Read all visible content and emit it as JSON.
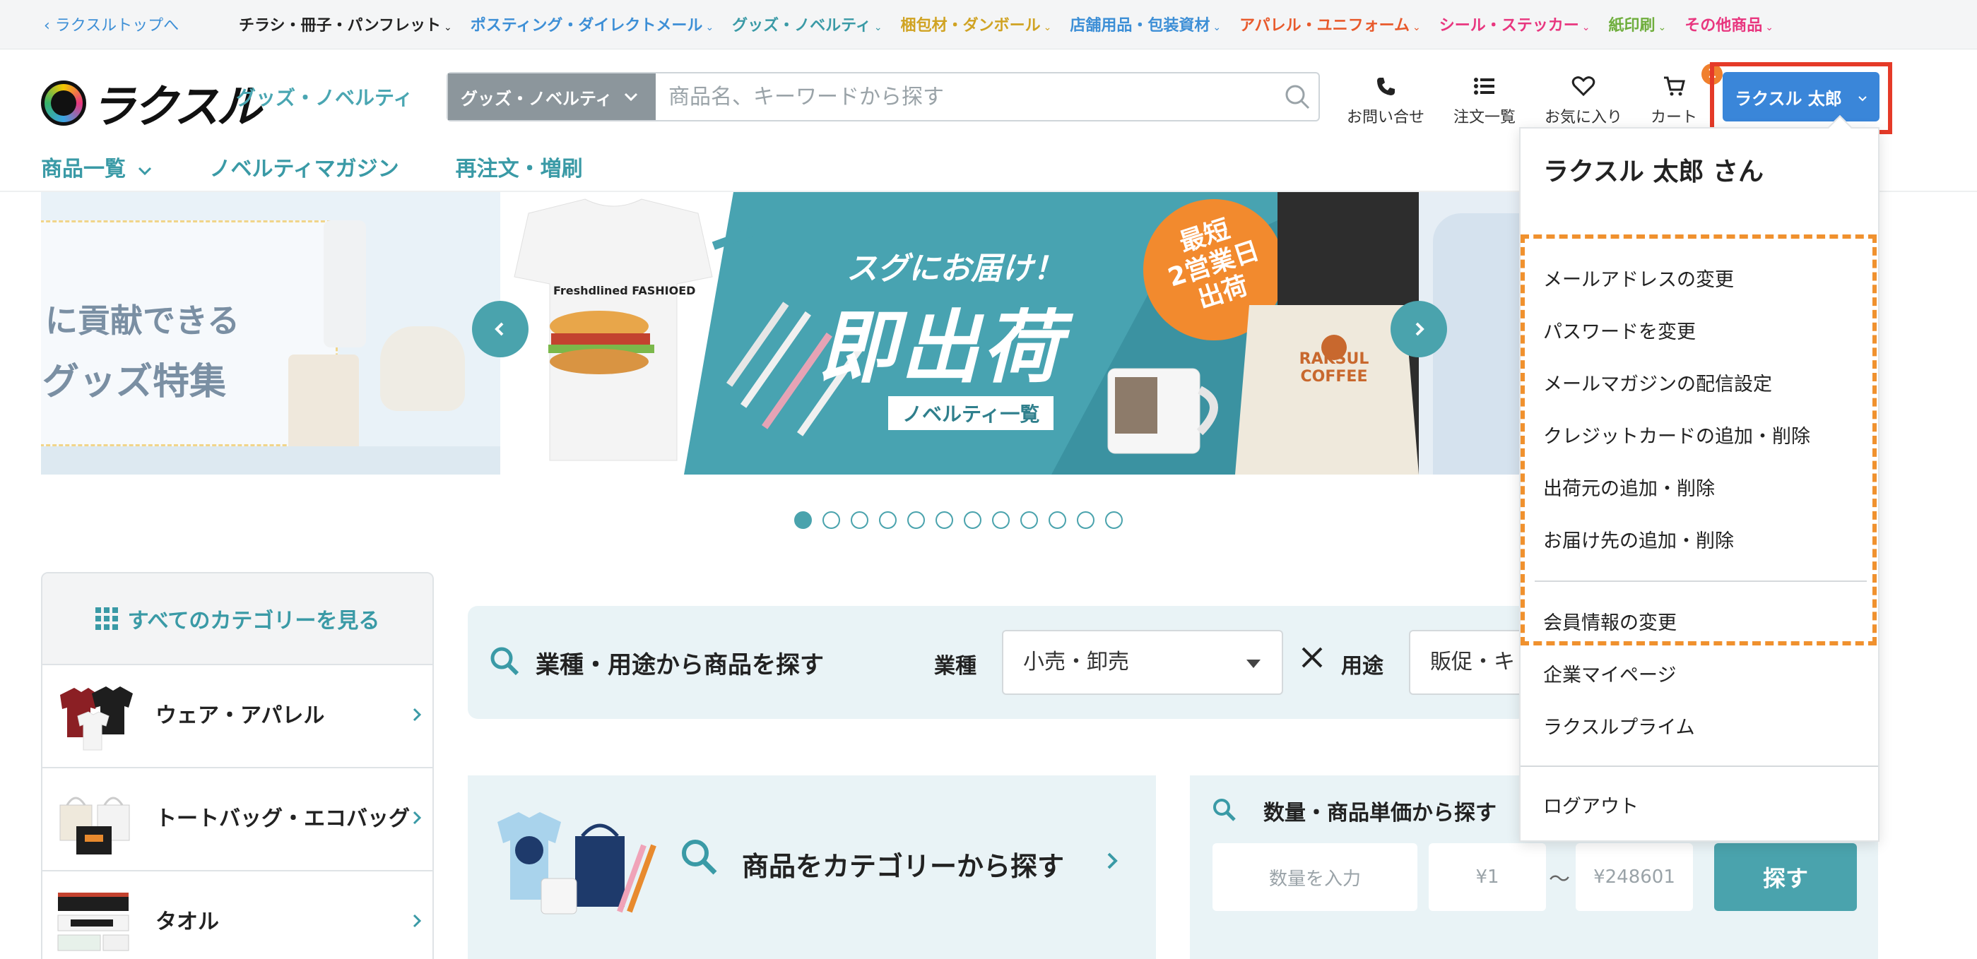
{
  "topbar": {
    "back_label": "ラクスルトップへ",
    "categories": [
      {
        "label": "チラシ・冊子・パンフレット",
        "color": "#222222"
      },
      {
        "label": "ポスティング・ダイレクトメール",
        "color": "#3d8fd6"
      },
      {
        "label": "グッズ・ノベルティ",
        "color": "#3a9aa6"
      },
      {
        "label": "梱包材・ダンボール",
        "color": "#d0a323"
      },
      {
        "label": "店舗用品・包装資材",
        "color": "#3d8fd6"
      },
      {
        "label": "アパレル・ユニフォーム",
        "color": "#e85a2c"
      },
      {
        "label": "シール・ステッカー",
        "color": "#e8367f"
      },
      {
        "label": "紙印刷",
        "color": "#6fae3d"
      },
      {
        "label": "その他商品",
        "color": "#e8367f"
      }
    ]
  },
  "header": {
    "logo_text": "ラクスル",
    "sub_label": "グッズ・ノベルティ",
    "search": {
      "category": "グッズ・ノベルティ",
      "placeholder": "商品名、キーワードから探す"
    },
    "icons": [
      {
        "label": "お問い合せ",
        "icon": "phone-icon"
      },
      {
        "label": "注文一覧",
        "icon": "list-icon"
      },
      {
        "label": "お気に入り",
        "icon": "heart-icon"
      },
      {
        "label": "カート",
        "icon": "cart-icon"
      }
    ],
    "cart_count": "1",
    "user_button": "ラクスル 太郎"
  },
  "nav": {
    "items": [
      "商品一覧",
      "ノベルティマガジン",
      "再注文・増刷"
    ]
  },
  "carousel": {
    "left_text_1": "に貢献できる",
    "left_text_2": "グッズ特集",
    "main_tag": "スグにお届け！",
    "main_title": "即出荷",
    "main_link": "ノベルティ一覧",
    "badge_1": "最短",
    "badge_2": "2営業日",
    "badge_3": "出荷",
    "tshirt_text": "Freshdlined FASHIOED",
    "bag_text_1": "RAKSUL",
    "bag_text_2": "COFFEE",
    "slide_count": 12,
    "active_index": 0
  },
  "sidebar": {
    "head": "すべてのカテゴリーを見る",
    "items": [
      {
        "label": "ウェア・アパレル"
      },
      {
        "label": "トートバッグ・エコバッグ"
      },
      {
        "label": "タオル"
      }
    ]
  },
  "industry_search": {
    "title": "業種・用途から商品を探す",
    "industry_label": "業種",
    "industry_value": "小売・卸売",
    "purpose_label": "用途",
    "purpose_value": "販促・キ"
  },
  "category_search": {
    "label": "商品をカテゴリーから探す"
  },
  "qty_search": {
    "title": "数量・商品単価から探す",
    "qty_placeholder": "数量を入力",
    "price_min": "¥1",
    "tilde": "〜",
    "price_max": "¥248601",
    "button": "探す"
  },
  "user_menu": {
    "name": "ラクスル 太郎 さん",
    "items": [
      "メールアドレスの変更",
      "パスワードを変更",
      "メールマガジンの配信設定",
      "クレジットカードの追加・削除",
      "出荷元の追加・削除",
      "お届け先の追加・削除"
    ],
    "member_info": "会員情報の変更",
    "company_page": "企業マイページ",
    "prime": "ラクスルプライム",
    "logout": "ログアウト"
  },
  "colors": {
    "accent_teal": "#4aa3ad",
    "user_button": "#3a86d9",
    "highlight_red": "#e53a28",
    "highlight_orange": "#f0912e",
    "badge_orange": "#f07f2d"
  }
}
